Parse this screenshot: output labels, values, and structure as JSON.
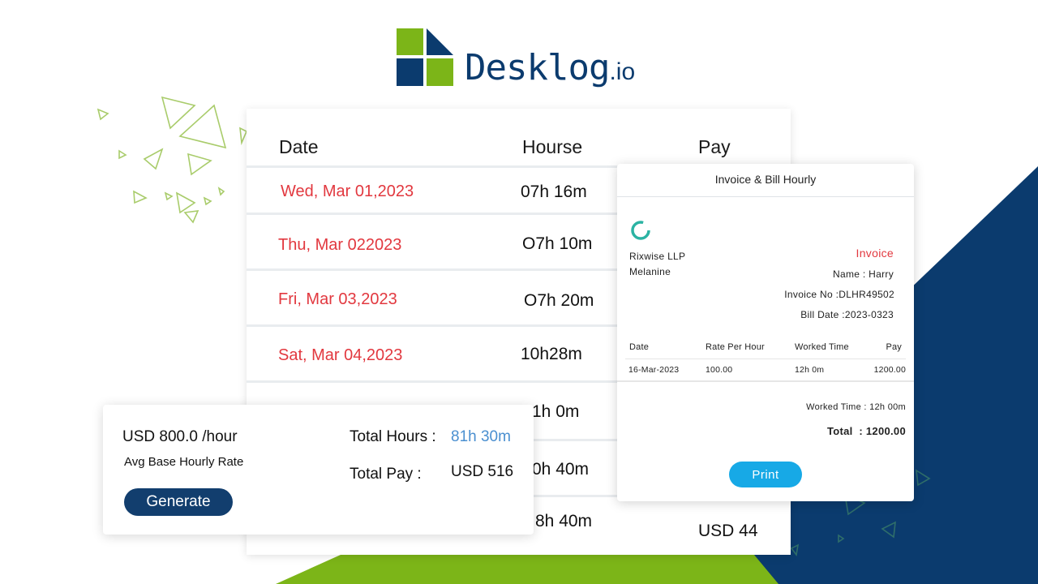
{
  "brand": {
    "name": "Desklog",
    "suffix": ".io",
    "colors": {
      "green": "#7cb518",
      "navy": "#0b3b6e"
    }
  },
  "timesheet": {
    "headers": {
      "date": "Date",
      "hours": "Hourse",
      "pay": "Pay"
    },
    "rows": [
      {
        "date": "Wed, Mar 01,2023",
        "hours": "07h 16m",
        "pay": ""
      },
      {
        "date": "Thu, Mar 022023",
        "hours": "O7h 10m",
        "pay": ""
      },
      {
        "date": "Fri, Mar 03,2023",
        "hours": "O7h 20m",
        "pay": ""
      },
      {
        "date": "Sat, Mar 04,2023",
        "hours": "10h28m",
        "pay": ""
      },
      {
        "date": "",
        "hours": "1h 0m",
        "pay": ""
      },
      {
        "date": "",
        "hours": "0h 40m",
        "pay": ""
      },
      {
        "date": "",
        "hours": "8h 40m",
        "pay": "USD 44"
      }
    ],
    "date_color": "#e2383f"
  },
  "summary": {
    "rate": "USD 800.0 /hour",
    "rate_label": "Avg Base Hourly Rate",
    "total_hours_label": "Total Hours :",
    "total_hours_value": "81h 30m",
    "total_pay_label": "Total Pay :",
    "total_pay_value": "USD 516",
    "generate_label": "Generate",
    "accent_color": "#4a8fd0"
  },
  "invoice": {
    "title": "Invoice & Bill Hourly",
    "company": "Rixwise LLP",
    "person": "Melanine",
    "heading": "Invoice",
    "name": "Name : Harry",
    "invoice_no": "Invoice No :DLHR49502",
    "bill_date": "Bill Date :2023-0323",
    "table": {
      "headers": [
        "Date",
        "Rate Per Hour",
        "Worked Time",
        "Pay"
      ],
      "row": [
        "16-Mar-2023",
        "100.00",
        "12h 0m",
        "1200.00"
      ]
    },
    "worked_time": "Worked Time : 12h 00m",
    "total": "Total  : 1200.00",
    "print_label": "Print",
    "print_color": "#17a9e6"
  }
}
